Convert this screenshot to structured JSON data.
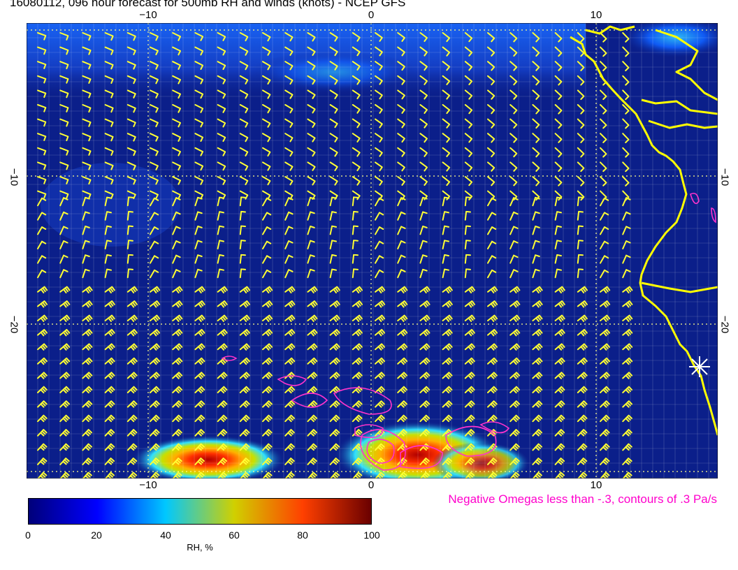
{
  "title": "16080112, 096 hour forecast for 500mb RH and winds (knots) - NCEP GFS",
  "axes": {
    "x_ticks": [
      "−10",
      "0",
      "10"
    ],
    "y_ticks": [
      "−10",
      "−20"
    ]
  },
  "omega_note": "Negative Omegas less than -.3, contours of .3 Pa/s",
  "colorbar": {
    "ticks": [
      "0",
      "20",
      "40",
      "60",
      "80",
      "100"
    ],
    "label": "RH, %",
    "colors": [
      "#00007a",
      "#0000ff",
      "#00c8ff",
      "#d0d000",
      "#ff4000",
      "#6a0000"
    ]
  },
  "colors": {
    "ocean_background": "#0b1f8a",
    "wind_barbs": "#ffff33",
    "coastline": "#ffff00",
    "omega_contours": "#ff33cc",
    "grid": "#ffffff"
  },
  "marker": "star-marker"
}
